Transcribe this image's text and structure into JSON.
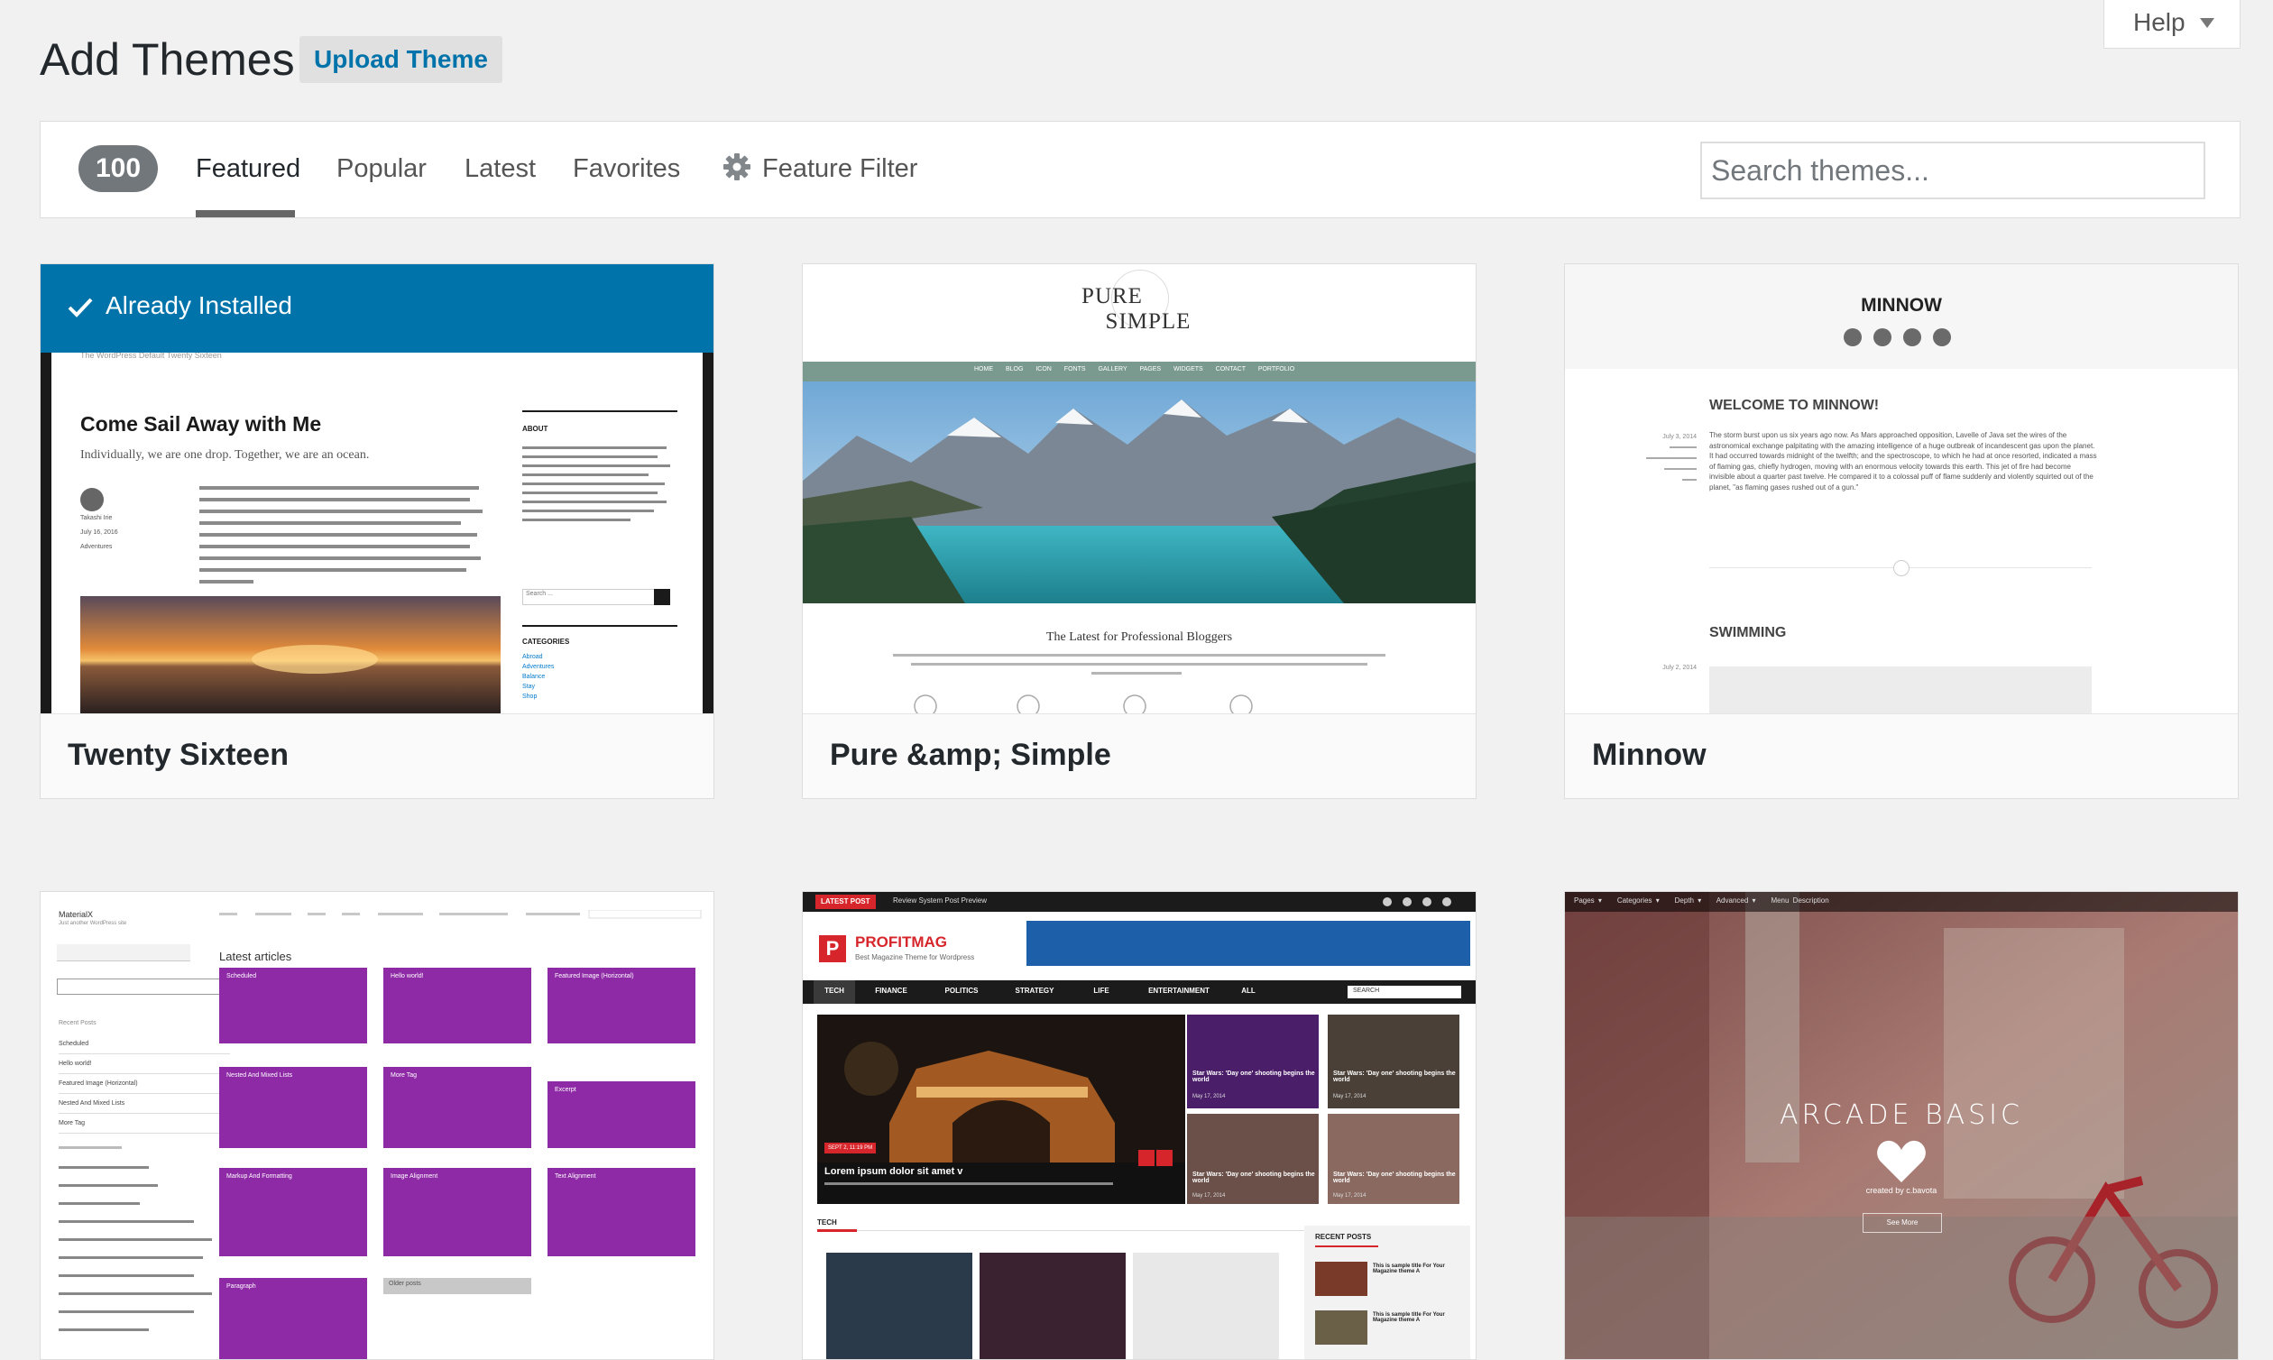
{
  "header": {
    "title": "Add Themes",
    "upload_label": "Upload Theme",
    "help_label": "Help"
  },
  "filter": {
    "count": "100",
    "tabs": [
      {
        "label": "Featured",
        "current": true
      },
      {
        "label": "Popular"
      },
      {
        "label": "Latest"
      },
      {
        "label": "Favorites"
      }
    ],
    "feature_filter_label": "Feature Filter",
    "search_placeholder": "Search themes..."
  },
  "themes": [
    {
      "name": "Twenty Sixteen",
      "installed_label": "Already Installed",
      "preview": {
        "header_text": "The WordPress Default Twenty Sixteen",
        "post_title": "Come Sail Away with Me",
        "post_subtitle": "Individually, we are one drop. Together, we are an ocean.",
        "author": "Takashi Irie",
        "date": "July 16, 2016",
        "category": "Adventures",
        "about_heading": "ABOUT",
        "search_label": "Search ...",
        "categories_heading": "CATEGORIES",
        "categories": [
          "Abroad",
          "Adventures",
          "Balance",
          "Stay",
          "Shop"
        ]
      }
    },
    {
      "name": "Pure &amp; Simple",
      "preview": {
        "logo_line1": "PURE",
        "logo_line2": "SIMPLE",
        "nav": [
          "HOME",
          "BLOG",
          "ICON FONTS",
          "GALLERY",
          "PAGES",
          "WIDGETS",
          "CONTACT",
          "PORTFOLIO"
        ],
        "tagline": "The Latest for Professional Bloggers"
      }
    },
    {
      "name": "Minnow",
      "preview": {
        "site_title": "MINNOW",
        "post1_title": "WELCOME TO MINNOW!",
        "post1_date": "July 3, 2014",
        "post1_text": "The storm burst upon us six years ago now. As Mars approached opposition, Lavelle of Java set the wires of the astronomical exchange palpitating with the amazing intelligence of a huge outbreak of incandescent gas upon the planet. It had occurred towards midnight of the twelfth; and the spectroscope, to which he had at once resorted, indicated a mass of flaming gas, chiefly hydrogen, moving with an enormous velocity towards this earth. This jet of fire had become invisible about a quarter past twelve. He compared it to a colossal puff of flame suddenly and violently squirted out of the planet, \"as flaming gases rushed out of a gun.\"",
        "post2_title": "SWIMMING",
        "post2_date": "July 2, 2014"
      }
    },
    {
      "name": "MaterialX",
      "preview": {
        "site_title": "MaterialX",
        "tagline": "Just another WordPress site",
        "heading": "Latest articles",
        "tiles": [
          "Scheduled",
          "Hello world!",
          "Featured Image (Horizontal)",
          "Nested And Mixed Lists",
          "More Tag",
          "Excerpt",
          "Markup And Formatting",
          "Image Alignment",
          "Text Alignment",
          "Paragraph"
        ],
        "recent_posts_heading": "Recent Posts",
        "recent_posts": [
          "Scheduled",
          "Hello world!",
          "Featured Image (Horizontal)",
          "Nested And Mixed Lists",
          "More Tag"
        ],
        "older_posts": "Older posts"
      }
    },
    {
      "name": "ProfitMag",
      "preview": {
        "top_label": "LATEST POST",
        "top_text": "Review System Post Preview",
        "logo": "PROFITMAG",
        "logo_tagline": "Best Magazine Theme for Wordpress",
        "nav": [
          "TECH",
          "FINANCE",
          "POLITICS",
          "STRATEGY",
          "LIFE",
          "ENTERTAINMENT",
          "ALL"
        ],
        "search_label": "SEARCH",
        "hero_title": "Lorem ipsum dolor sit amet v",
        "hero_date": "SEPT 2, 11:19 PM",
        "side_title": "Star Wars: 'Day one' shooting begins the world",
        "side_date": "May 17, 2014",
        "section_label": "TECH",
        "recent_heading": "RECENT POSTS",
        "recent_title": "This is sample title For Your Magazine theme A"
      }
    },
    {
      "name": "Arcade Basic",
      "preview": {
        "menu": [
          "Pages",
          "Categories",
          "Depth",
          "Advanced",
          "Menu Description"
        ],
        "logo_text": "ARCADE BASIC",
        "credit": "created by c.bavota",
        "button": "See More"
      }
    }
  ]
}
